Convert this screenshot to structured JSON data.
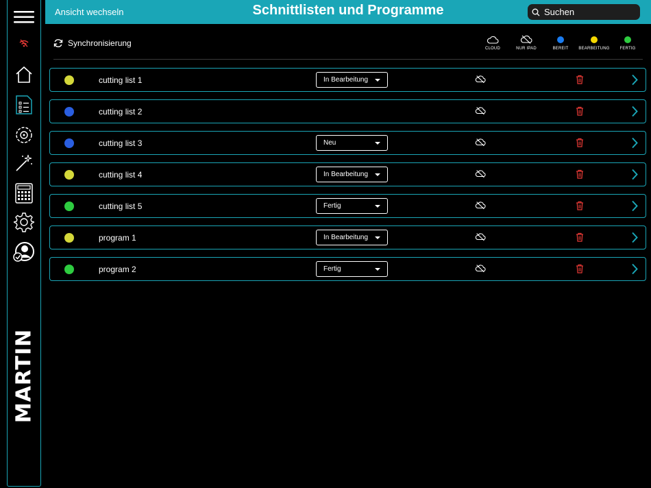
{
  "header": {
    "view_switch": "Ansicht wechseln",
    "title": "Schnittlisten und Programme",
    "search_placeholder": "Suchen"
  },
  "toolbar": {
    "sync_label": "Synchronisierung",
    "legend": [
      {
        "label": "CLOUD",
        "icon": "cloud-icon"
      },
      {
        "label": "NUR IPAD",
        "icon": "cloud-off-icon"
      },
      {
        "label": "BEREIT",
        "color": "#1a7cf0"
      },
      {
        "label": "BEARBEITUNG",
        "color": "#f5d800"
      },
      {
        "label": "FERTIG",
        "color": "#2ecc40"
      }
    ]
  },
  "status_colors": {
    "yellow": "#d4d83a",
    "blue": "#2a5ee0",
    "green": "#2ecc40"
  },
  "rows": [
    {
      "name": "cutting list 1",
      "status_color": "#d4d83a",
      "status": "In Bearbeitung"
    },
    {
      "name": "cutting list 2",
      "status_color": "#2a5ee0",
      "status": ""
    },
    {
      "name": "cutting list 3",
      "status_color": "#2a5ee0",
      "status": "Neu"
    },
    {
      "name": "cutting list 4",
      "status_color": "#d4d83a",
      "status": "In Bearbeitung"
    },
    {
      "name": "cutting list 5",
      "status_color": "#2ecc40",
      "status": "Fertig"
    },
    {
      "name": "program 1",
      "status_color": "#d4d83a",
      "status": "In Bearbeitung"
    },
    {
      "name": "program 2",
      "status_color": "#2ecc40",
      "status": "Fertig"
    }
  ],
  "sidebar": {
    "items": [
      "menu-icon",
      "wifi-off-icon",
      "home-icon",
      "list-icon",
      "saw-blade-icon",
      "magic-wand-icon",
      "calculator-icon",
      "settings-icon",
      "user-check-icon"
    ],
    "brand": "MARTIN"
  },
  "accent": "#1aa6b7"
}
